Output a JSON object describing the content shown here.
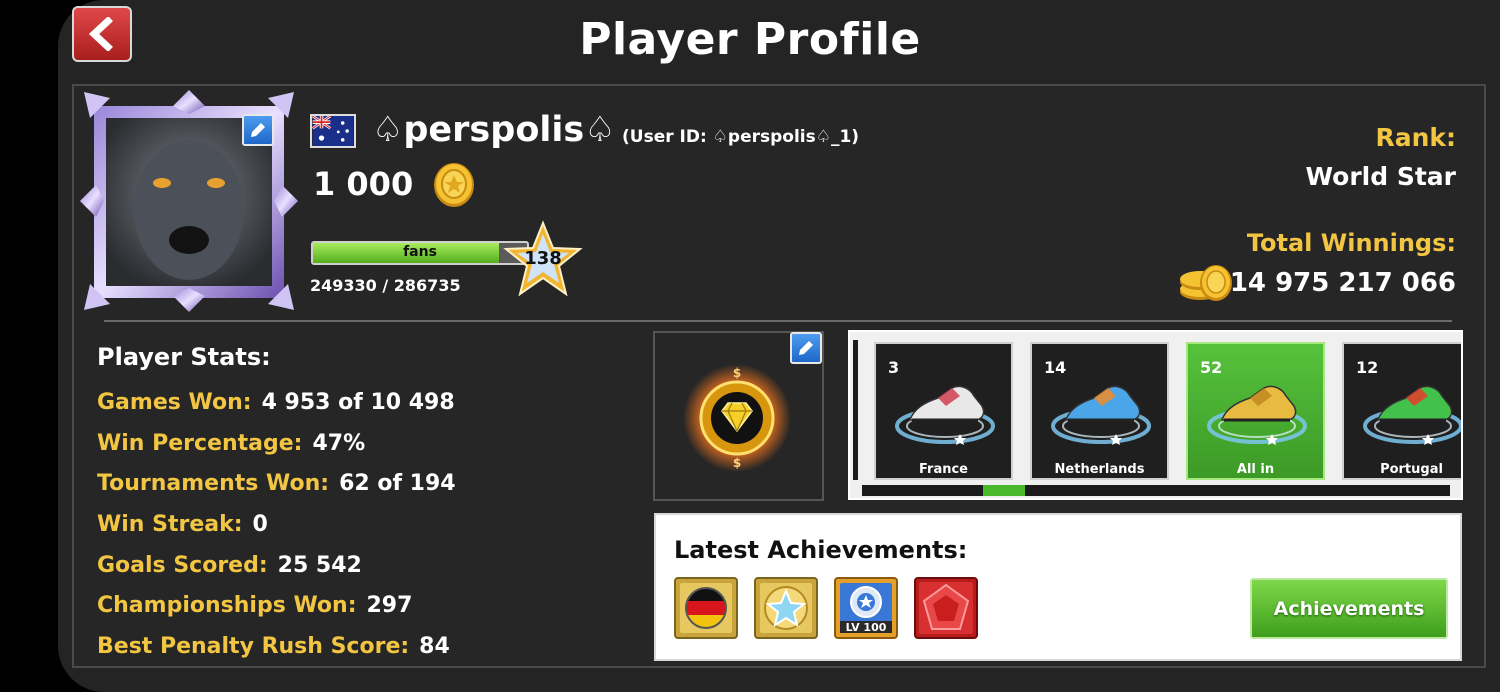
{
  "header": {
    "title": "Player Profile"
  },
  "player": {
    "name": "♤perspolis♤",
    "user_id": "(User ID: ♤perspolis♤_1)",
    "coins": "1 000",
    "fans_label": "fans",
    "fans_count": "249330 / 286735",
    "fans_progress": 0.87,
    "level": "138",
    "country": "Australia"
  },
  "rank": {
    "label": "Rank:",
    "value": "World Star"
  },
  "winnings": {
    "label": "Total Winnings:",
    "value": "14 975 217 066"
  },
  "stats": {
    "title": "Player Stats:",
    "rows": [
      {
        "label": "Games Won:",
        "value": "4 953 of 10 498"
      },
      {
        "label": "Win Percentage:",
        "value": "47%"
      },
      {
        "label": "Tournaments Won:",
        "value": "62 of 194"
      },
      {
        "label": "Win Streak:",
        "value": "0"
      },
      {
        "label": "Goals Scored:",
        "value": "25 542"
      },
      {
        "label": "Championships Won:",
        "value": "297"
      },
      {
        "label": "Best Penalty Rush Score:",
        "value": "84"
      }
    ]
  },
  "boots": [
    {
      "count": "3",
      "name": "France",
      "color": "#e8e8e8",
      "accent": "#d04050"
    },
    {
      "count": "14",
      "name": "Netherlands",
      "color": "#4aa6e8",
      "accent": "#f08a2a"
    },
    {
      "count": "52",
      "name": "All in",
      "color": "#e7bb40",
      "accent": "#c08820",
      "selected": true
    },
    {
      "count": "12",
      "name": "Portugal",
      "color": "#42c24a",
      "accent": "#e83a2a"
    }
  ],
  "achievements": {
    "title": "Latest Achievements:",
    "button_label": "Achievements",
    "level_badge": "LV 100",
    "icons": [
      "germany-flag-achievement-icon",
      "star-achievement-icon",
      "level-100-achievement-icon",
      "red-gem-achievement-icon"
    ]
  },
  "colors": {
    "accent_gold": "#f2c542",
    "green": "#49b82a"
  }
}
